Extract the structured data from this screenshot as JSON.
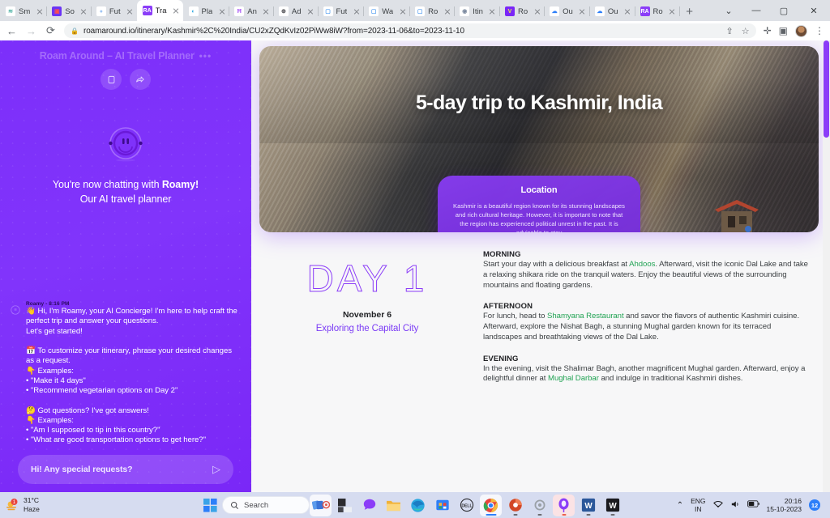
{
  "browser": {
    "tabs": [
      {
        "title": "Sm",
        "favicon": "stripe-icon",
        "color": "#ffffff",
        "glyph": "≋",
        "glyph_color": "#4fb3a6",
        "active": false
      },
      {
        "title": "So",
        "favicon": "sora-icon",
        "color": "#6b35f5",
        "glyph": "▣",
        "glyph_color": "#ff4d4d",
        "active": false
      },
      {
        "title": "Fut",
        "favicon": "future-icon",
        "color": "#ffffff",
        "glyph": "●",
        "glyph_color": "#9fc6f5",
        "active": false
      },
      {
        "title": "Tra",
        "favicon": "roam-around-icon",
        "color": "#8b3df8",
        "glyph": "RA",
        "glyph_color": "#ffffff",
        "active": true
      },
      {
        "title": "Pla",
        "favicon": "globe-blue-icon",
        "color": "#ffffff",
        "glyph": "◐",
        "glyph_color": "#2aa7e0",
        "active": false
      },
      {
        "title": "An",
        "favicon": "anytype-icon",
        "color": "#ffffff",
        "glyph": "Ħ",
        "glyph_color": "#a44ef5",
        "active": false
      },
      {
        "title": "Ad",
        "favicon": "globe-icon",
        "color": "#ffffff",
        "glyph": "⊕",
        "glyph_color": "#4a4a4f",
        "active": false
      },
      {
        "title": "Fut",
        "favicon": "window-icon",
        "color": "#ffffff",
        "glyph": "▢",
        "glyph_color": "#4f9bf0",
        "active": false
      },
      {
        "title": "Wa",
        "favicon": "window-icon",
        "color": "#ffffff",
        "glyph": "▢",
        "glyph_color": "#4f9bf0",
        "active": false
      },
      {
        "title": "Ro",
        "favicon": "window-icon",
        "color": "#ffffff",
        "glyph": "▢",
        "glyph_color": "#4f9bf0",
        "active": false
      },
      {
        "title": "Itin",
        "favicon": "compass-icon",
        "color": "#ffffff",
        "glyph": "◉",
        "glyph_color": "#7c8aa0",
        "active": false
      },
      {
        "title": "Ro",
        "favicon": "yellow-v-icon",
        "color": "#7a27f7",
        "glyph": "V",
        "glyph_color": "#e9e84a",
        "active": false
      },
      {
        "title": "Ou",
        "favicon": "outlook-icon",
        "color": "#ffffff",
        "glyph": "☁",
        "glyph_color": "#2d7ff9",
        "active": false
      },
      {
        "title": "Ou",
        "favicon": "outlook-icon",
        "color": "#ffffff",
        "glyph": "☁",
        "glyph_color": "#2d7ff9",
        "active": false
      },
      {
        "title": "Ro",
        "favicon": "roam-around-icon",
        "color": "#8b3df8",
        "glyph": "RA",
        "glyph_color": "#ffffff",
        "active": false
      }
    ],
    "new_tab_label": "+",
    "window_controls": {
      "tab_search": "⌄",
      "minimize": "—",
      "maximize": "▢",
      "close": "✕"
    },
    "nav": {
      "back": "←",
      "forward": "→",
      "reload": "⟳"
    },
    "omnibox": {
      "lock": "🔒",
      "url": "roamaround.io/itinerary/Kashmir%2C%20India/CU2xZQdKvIz02PiWw8iW?from=2023-11-06&to=2023-11-10"
    },
    "omni_icons": {
      "share": "⇪",
      "bookmark": "☆"
    },
    "toolbar_icons": {
      "extensions": "✛",
      "side_panel": "▣",
      "menu": "⋮"
    }
  },
  "chat": {
    "title": "Roam Around – AI Travel Planner",
    "menu_dots": "•••",
    "header_buttons": [
      {
        "name": "new-chat-button",
        "glyph": "▢"
      },
      {
        "name": "share-button",
        "glyph": "↪"
      }
    ],
    "welcome_line1_prefix": "You're now chatting with ",
    "welcome_line1_bold": "Roamy!",
    "welcome_line2": "Our AI travel planner",
    "message": {
      "sender": "Roamy",
      "time": "8:16 PM",
      "text": "👋 Hi, I'm Roamy, your AI Concierge! I'm here to help craft the perfect trip and answer your questions.\nLet's get started!\n\n📅 To customize your itinerary, phrase your desired changes as a request.\n👇 Examples:\n• \"Make it 4 days\"\n• \"Recommend vegetarian options on Day 2\"\n\n🤔 Got questions? I've got answers!\n👇 Examples:\n• \"Am I supposed to tip in this country?\"\n• \"What are good transportation options to get here?\""
    },
    "input_placeholder": "Hi! Any special requests?",
    "send_glyph": "▷"
  },
  "itinerary": {
    "hero_title": "5-day trip to Kashmir, India",
    "location_card": {
      "heading": "Location",
      "body": "Kashmir is a beautiful region known for its stunning landscapes and rich cultural heritage. However, it is important to note that the region has experienced political unrest in the past. It is advisable to stay",
      "icons": [
        {
          "name": "info-icon",
          "glyph": "?",
          "active": true
        },
        {
          "name": "network-icon",
          "glyph": "⚛",
          "active": false
        },
        {
          "name": "currency-icon",
          "glyph": "$",
          "active": false
        },
        {
          "name": "language-icon",
          "glyph": "💬",
          "active": false
        }
      ]
    },
    "day": {
      "number": "DAY 1",
      "date": "November 6",
      "subtitle": "Exploring the Capital City",
      "segments": [
        {
          "label": "MORNING",
          "parts": [
            {
              "t": "Start your day with a delicious breakfast at ",
              "link": false
            },
            {
              "t": "Ahdoos",
              "link": true
            },
            {
              "t": ". Afterward, visit the iconic Dal Lake and take a relaxing shikara ride on the tranquil waters. Enjoy the beautiful views of the surrounding mountains and floating gardens.",
              "link": false
            }
          ]
        },
        {
          "label": "AFTERNOON",
          "parts": [
            {
              "t": "For lunch, head to ",
              "link": false
            },
            {
              "t": "Shamyana Restaurant",
              "link": true
            },
            {
              "t": " and savor the flavors of authentic Kashmiri cuisine. Afterward, explore the Nishat Bagh, a stunning Mughal garden known for its terraced landscapes and breathtaking views of the Dal Lake.",
              "link": false
            }
          ]
        },
        {
          "label": "EVENING",
          "parts": [
            {
              "t": "In the evening, visit the Shalimar Bagh, another magnificent Mughal garden. Afterward, enjoy a delightful dinner at ",
              "link": false
            },
            {
              "t": "Mughal Darbar",
              "link": true
            },
            {
              "t": " and indulge in traditional Kashmiri dishes.",
              "link": false
            }
          ]
        }
      ]
    }
  },
  "taskbar": {
    "weather": {
      "temp": "31°C",
      "condition": "Haze",
      "icon": "haze-icon",
      "badge": "1"
    },
    "start_label": "start-icon",
    "search_placeholder": "Search",
    "search_icon": "search-icon",
    "apps": [
      {
        "name": "taskview-icon",
        "glyph": "🗂",
        "state": "sel"
      },
      {
        "name": "widgets-icon",
        "glyph": "◧",
        "state": ""
      },
      {
        "name": "chat-icon",
        "glyph": "💬",
        "state": ""
      },
      {
        "name": "file-explorer-icon",
        "glyph": "📁",
        "state": ""
      },
      {
        "name": "edge-icon",
        "glyph": "◉",
        "state": ""
      },
      {
        "name": "microsoft-store-icon",
        "glyph": "🛍",
        "state": ""
      },
      {
        "name": "dell-icon",
        "glyph": "DELL",
        "state": ""
      },
      {
        "name": "chrome-icon",
        "glyph": "◎",
        "state": "sel"
      },
      {
        "name": "powerpoint-icon",
        "glyph": "P",
        "state": ""
      },
      {
        "name": "settings-icon",
        "glyph": "⚙",
        "state": ""
      },
      {
        "name": "balloon-app-icon",
        "glyph": "◍",
        "state": "tint"
      },
      {
        "name": "word-icon",
        "glyph": "W",
        "state": ""
      },
      {
        "name": "wps-icon",
        "glyph": "W",
        "state": ""
      }
    ],
    "tray": {
      "chevron": "⌃",
      "language": "ENG",
      "region": "IN",
      "wifi": "⌃",
      "volume": "🔊",
      "battery": "▭",
      "time": "20:16",
      "date": "15-10-2023",
      "notification_count": "12"
    }
  },
  "colors": {
    "brand_purple": "#7B2BF9",
    "link_green": "#22a354",
    "accent_violet": "#8b3df8",
    "page_bg": "#f7f7f8"
  }
}
